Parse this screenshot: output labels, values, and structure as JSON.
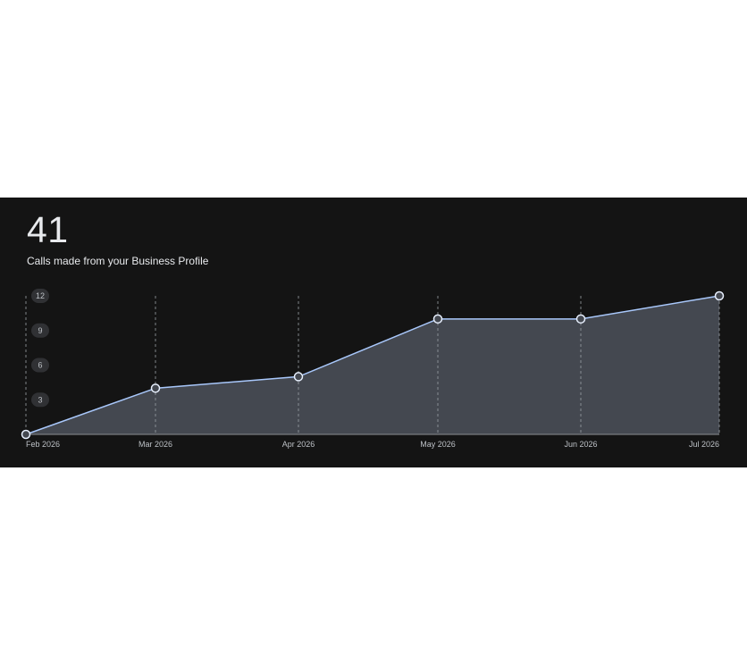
{
  "card": {
    "total": "41",
    "subtitle": "Calls made from your Business Profile"
  },
  "colors": {
    "background": "#141414",
    "line": "#a8c7fa",
    "area": "#444850",
    "grid": "#9aa0a6",
    "badge": "#303134"
  },
  "chart_data": {
    "type": "area",
    "x": [
      "Feb 2026",
      "Mar 2026",
      "Apr 2026",
      "May 2026",
      "Jun 2026",
      "Jul 2026"
    ],
    "series": [
      {
        "values": [
          0,
          4,
          5,
          10,
          10,
          12
        ]
      }
    ],
    "y_ticks": [
      3,
      6,
      9,
      12
    ],
    "ylim": [
      0,
      12
    ],
    "grid": "vertical dashed",
    "legend": "none"
  }
}
